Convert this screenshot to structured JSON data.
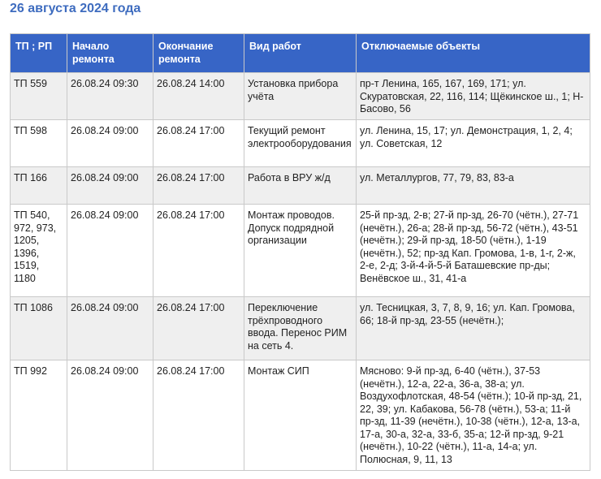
{
  "page": {
    "title": "26 августа 2024 года"
  },
  "table": {
    "headers": {
      "tp": "ТП ; РП",
      "start": "Начало ремонта",
      "end": "Окончание ремонта",
      "work": "Вид работ",
      "objects": "Отключаемые объекты"
    },
    "rows": [
      {
        "tp": "ТП 559",
        "start": "26.08.24 09:30",
        "end": "26.08.24 14:00",
        "work": "Установка прибора учёта",
        "objects": "пр-т Ленина, 165, 167, 169, 171; ул. Скуратовская, 22, 116, 114; Щёкинское ш., 1; Н-Басово, 56"
      },
      {
        "tp": "ТП 598",
        "start": "26.08.24 09:00",
        "end": "26.08.24 17:00",
        "work": "Текущий ремонт электрооборудования",
        "objects": "ул. Ленина, 15, 17; ул. Демонстрация, 1, 2, 4; ул. Советская, 12"
      },
      {
        "tp": "ТП 166",
        "start": "26.08.24 09:00",
        "end": "26.08.24 17:00",
        "work": "Работа в ВРУ ж/д",
        "objects": "ул. Металлургов, 77, 79, 83, 83-а"
      },
      {
        "tp": "ТП 540, 972, 973, 1205, 1396, 1519, 1180",
        "start": "26.08.24 09:00",
        "end": "26.08.24 17:00",
        "work": "Монтаж проводов. Допуск подрядной организации",
        "objects": "25-й пр-зд, 2-в; 27-й пр-зд, 26-70 (чётн.), 27-71 (нечётн.), 26-а; 28-й пр-зд, 56-72 (чётн.), 43-51 (нечётн.); 29-й пр-зд, 18-50 (чётн.), 1-19 (нечётн.), 52; пр-зд Кап. Громова, 1-в, 1-г, 2-ж, 2-е, 2-д; 3-й-4-й-5-й Баташевские пр-ды; Венёвское ш., 31, 41-а"
      },
      {
        "tp": "ТП 1086",
        "start": "26.08.24 09:00",
        "end": "26.08.24 17:00",
        "work": "Переключение трёхпроводного ввода. Перенос РИМ на сеть 4.",
        "objects": "ул. Тесницкая, 3, 7, 8, 9, 16; ул. Кап. Громова, 66; 18-й пр-зд, 23-55 (нечётн.);"
      },
      {
        "tp": "ТП 992",
        "start": "26.08.24 09:00",
        "end": "26.08.24 17:00",
        "work": "Монтаж СИП",
        "objects": "Мясново: 9-й пр-зд, 6-40 (чётн.), 37-53 (нечётн.), 12-а, 22-а, 36-а, 38-а; ул. Воздухофлотская, 48-54 (чётн.); 10-й пр-зд, 21, 22, 39; ул. Кабакова, 56-78 (чётн.), 53-а; 11-й пр-зд, 11-39 (нечётн.), 10-38 (чётн.), 12-а, 13-а, 17-а, 30-а, 32-а, 33-б, 35-а; 12-й пр-зд, 9-21 (нечётн.), 10-22 (чётн.), 11-а, 14-а; ул. Полюсная, 9, 11, 13"
      }
    ]
  }
}
